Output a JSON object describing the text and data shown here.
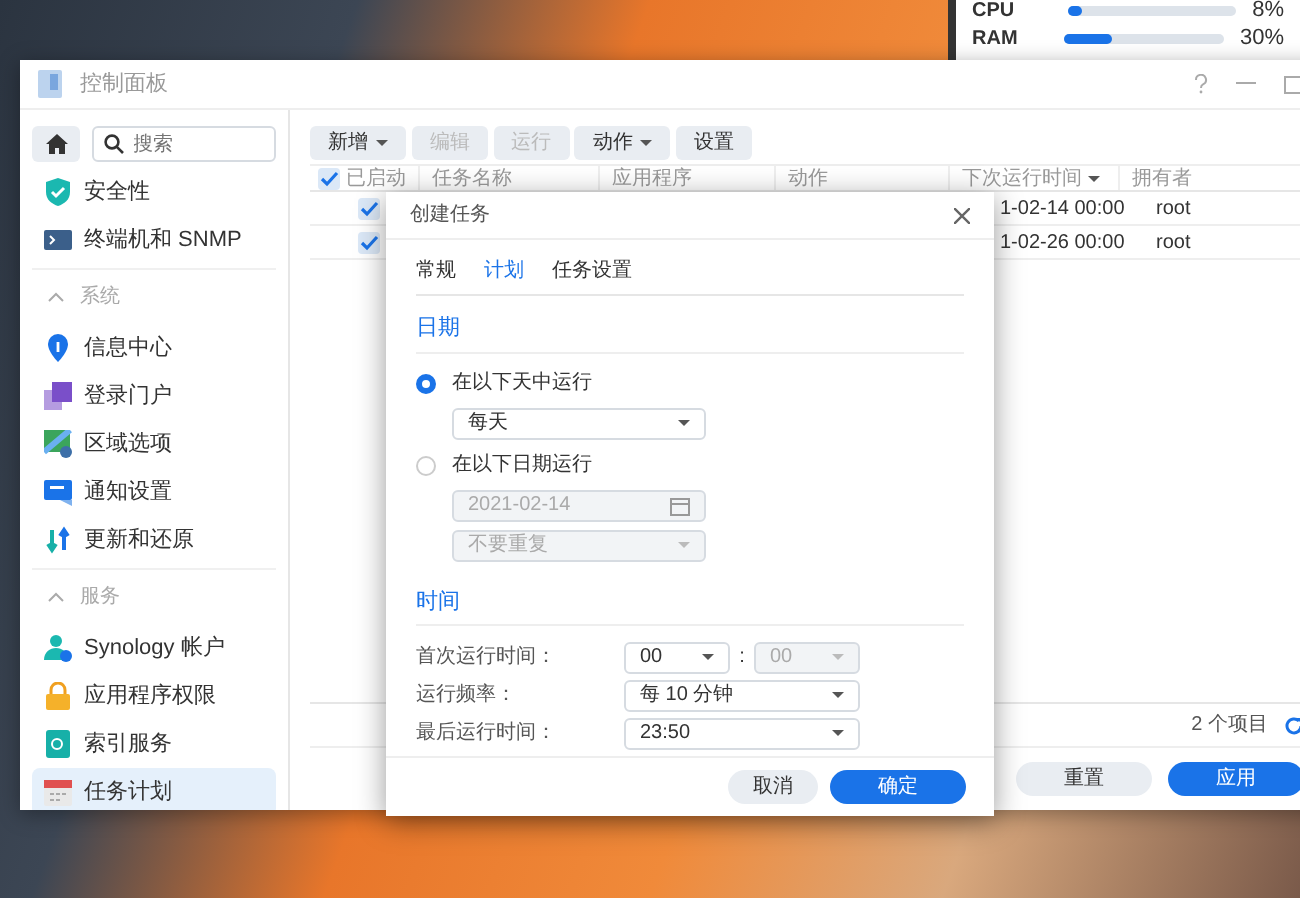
{
  "resource_monitor": {
    "rows": [
      {
        "label": "CPU",
        "level": 0.08,
        "reading": "8%"
      },
      {
        "label": "RAM",
        "level": 0.3,
        "reading": "30%"
      }
    ]
  },
  "window": {
    "title": "控制面板"
  },
  "sidebar": {
    "search": {
      "placeholder": "搜索"
    },
    "items": [
      {
        "kind": "item",
        "label": "安全性",
        "selected": false
      },
      {
        "kind": "item",
        "label": "终端机和 SNMP",
        "selected": false
      },
      {
        "kind": "section",
        "label": "系统",
        "expanded": true
      },
      {
        "kind": "item",
        "label": "信息中心",
        "selected": false
      },
      {
        "kind": "item",
        "label": "登录门户",
        "selected": false
      },
      {
        "kind": "item",
        "label": "区域选项",
        "selected": false
      },
      {
        "kind": "item",
        "label": "通知设置",
        "selected": false
      },
      {
        "kind": "item",
        "label": "更新和还原",
        "selected": false
      },
      {
        "kind": "section",
        "label": "服务",
        "expanded": true
      },
      {
        "kind": "item",
        "label": "Synology 帐户",
        "selected": false
      },
      {
        "kind": "item",
        "label": "应用程序权限",
        "selected": false
      },
      {
        "kind": "item",
        "label": "索引服务",
        "selected": false
      },
      {
        "kind": "item",
        "label": "任务计划",
        "selected": true
      }
    ]
  },
  "toolbar": [
    {
      "label": "新增",
      "dropdown": true,
      "disabled": false
    },
    {
      "label": "编辑",
      "dropdown": false,
      "disabled": true
    },
    {
      "label": "运行",
      "dropdown": false,
      "disabled": true
    },
    {
      "label": "动作",
      "dropdown": true,
      "disabled": false
    },
    {
      "label": "设置",
      "dropdown": false,
      "disabled": false
    }
  ],
  "table": {
    "all_checked": true,
    "columns": [
      {
        "label": "已启动",
        "sorted": false
      },
      {
        "label": "任务名称",
        "sorted": false
      },
      {
        "label": "应用程序",
        "sorted": false
      },
      {
        "label": "动作",
        "sorted": false
      },
      {
        "label": "下次运行时间",
        "sorted": true
      },
      {
        "label": "拥有者",
        "sorted": false
      }
    ],
    "rows": [
      {
        "checked": true,
        "next_run": "1-02-14 00:00",
        "owner": "root"
      },
      {
        "checked": true,
        "next_run": "1-02-26 00:00",
        "owner": "root"
      }
    ],
    "count": "2 个项目"
  },
  "buttons": [
    {
      "label": "重置",
      "kind": "secondary"
    },
    {
      "label": "应用",
      "kind": "primary"
    }
  ],
  "dialog": {
    "title": "创建任务",
    "tabs": [
      {
        "label": "常规",
        "selected": false
      },
      {
        "label": "计划",
        "selected": true
      },
      {
        "label": "任务设置",
        "selected": false
      }
    ],
    "date_section": {
      "title": "日期",
      "options": [
        {
          "label": "在以下天中运行",
          "selected": true,
          "fields": [
            {
              "kind": "select",
              "value": "每天",
              "disabled": false
            }
          ]
        },
        {
          "label": "在以下日期运行",
          "selected": false,
          "fields": [
            {
              "kind": "date",
              "value": "2021-02-14",
              "disabled": true
            },
            {
              "kind": "select",
              "value": "不要重复",
              "disabled": true
            }
          ]
        }
      ]
    },
    "time_section": {
      "title": "时间",
      "rows": [
        {
          "label": "首次运行时间：",
          "fields": [
            {
              "kind": "select",
              "value": "00",
              "disabled": false
            },
            {
              "kind": "separator",
              "value": ":"
            },
            {
              "kind": "select",
              "value": "00",
              "disabled": true
            }
          ]
        },
        {
          "label": "运行频率：",
          "fields": [
            {
              "kind": "select",
              "value": "每 10 分钟",
              "disabled": false
            }
          ]
        },
        {
          "label": "最后运行时间：",
          "fields": [
            {
              "kind": "select",
              "value": "23:50",
              "disabled": false
            }
          ]
        }
      ]
    },
    "buttons": [
      {
        "label": "取消",
        "kind": "secondary"
      },
      {
        "label": "确定",
        "kind": "primary"
      }
    ]
  }
}
